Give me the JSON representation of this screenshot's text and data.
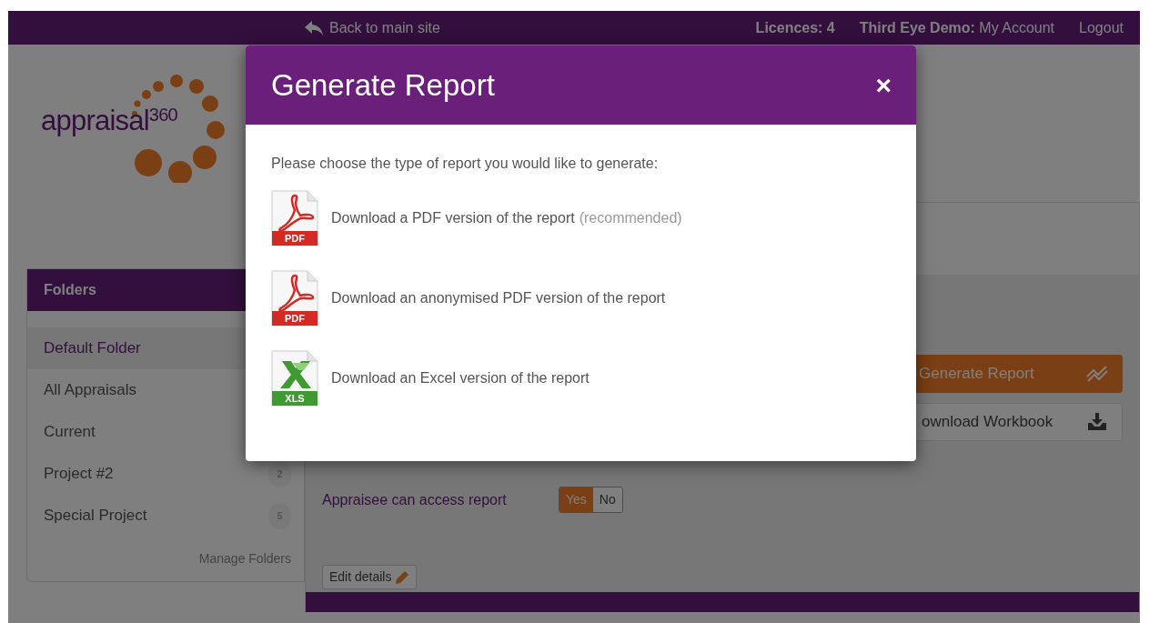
{
  "top_bar": {
    "back_link": "Back to main site",
    "licences": "Licences: 4",
    "account": "**Third Eye Demo:** My Account",
    "logout": "Logout"
  },
  "logo": {
    "text": "appraisal$^{360}$"
  },
  "folders": {
    "title": "Folders",
    "items": [
      {
        "label": "Default Folder",
        "selected": true
      },
      {
        "label": "All Appraisals",
        "selected": false
      },
      {
        "label": "Current",
        "selected": false
      },
      {
        "label": "Project #2",
        "selected": false,
        "count": "2"
      },
      {
        "label": "Special Project",
        "selected": false,
        "count": "5"
      }
    ],
    "manage_link": "Manage Folders"
  },
  "actions": [
    {
      "label": "Generate Report",
      "kind": "primary"
    },
    {
      "label": "ownload Workbook",
      "kind": "secondary"
    }
  ],
  "details": {
    "access_label": "Appraisee can access report",
    "access_toggle": [
      {
        "label": "Yes",
        "selected": true
      },
      {
        "label": "No",
        "selected": false
      }
    ],
    "edit_button": "Edit details"
  },
  "modal": {
    "title": "Generate Report",
    "close": "×",
    "prompt": "Please choose the type of report you would like to generate:",
    "options": [
      {
        "kind": "pdf",
        "file_label": "PDF",
        "label": "Download a PDF version of the report",
        "note": "(recommended)"
      },
      {
        "kind": "pdf",
        "file_label": "PDF",
        "label": "Download an anonymised PDF version of the report"
      },
      {
        "kind": "xls",
        "file_label": "XLS",
        "label": "Download an Excel version of the report"
      }
    ]
  }
}
